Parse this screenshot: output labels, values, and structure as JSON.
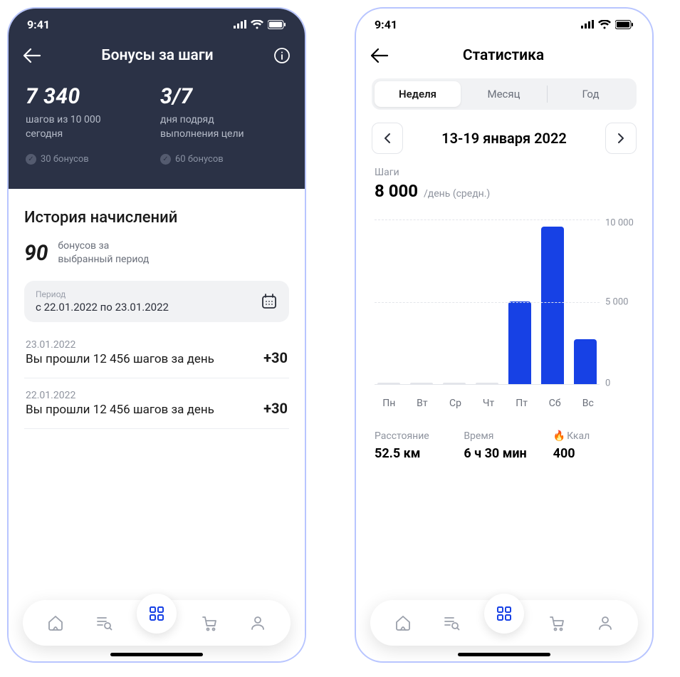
{
  "status": {
    "time": "9:41"
  },
  "screenA": {
    "title": "Бонусы за шаги",
    "steps": {
      "value": "7 340",
      "sub1": "шагов из 10 000",
      "sub2": "сегодня",
      "bonus": "30 бонусов"
    },
    "streak": {
      "value": "3/7",
      "sub1": "дня подряд",
      "sub2": "выполнения цели",
      "bonus": "60 бонусов"
    },
    "history_title": "История начислений",
    "bonus_total": {
      "value": "90",
      "sub1": "бонусов за",
      "sub2": "выбранный период"
    },
    "period": {
      "label": "Период",
      "value": "с 22.01.2022 по 23.01.2022"
    },
    "items": [
      {
        "date": "23.01.2022",
        "desc": "Вы прошли 12 456 шагов за день",
        "amount": "+30"
      },
      {
        "date": "22.01.2022",
        "desc": "Вы прошли 12 456 шагов за день",
        "amount": "+30"
      }
    ]
  },
  "screenB": {
    "title": "Статистика",
    "tabs": [
      "Неделя",
      "Месяц",
      "Год"
    ],
    "range": "13-19 января 2022",
    "steps_label": "Шаги",
    "steps_value": "8 000",
    "steps_unit": "/день (средн.)",
    "y_ticks": [
      "10 000",
      "5 000",
      "0"
    ],
    "x_labels": [
      "Пн",
      "Вт",
      "Ср",
      "Чт",
      "Пт",
      "Сб",
      "Вс"
    ],
    "stats": {
      "distance_lbl": "Расстояние",
      "distance_val": "52.5 км",
      "time_lbl": "Время",
      "time_val": "6 ч 30 мин",
      "kcal_lbl": "Ккал",
      "kcal_val": "400"
    }
  },
  "chart_data": {
    "type": "bar",
    "categories": [
      "Пн",
      "Вт",
      "Ср",
      "Чт",
      "Пт",
      "Сб",
      "Вс"
    ],
    "values": [
      0,
      0,
      0,
      0,
      5500,
      10500,
      3000
    ],
    "title": "Шаги",
    "xlabel": "",
    "ylabel": "",
    "ylim": [
      0,
      11000
    ]
  }
}
